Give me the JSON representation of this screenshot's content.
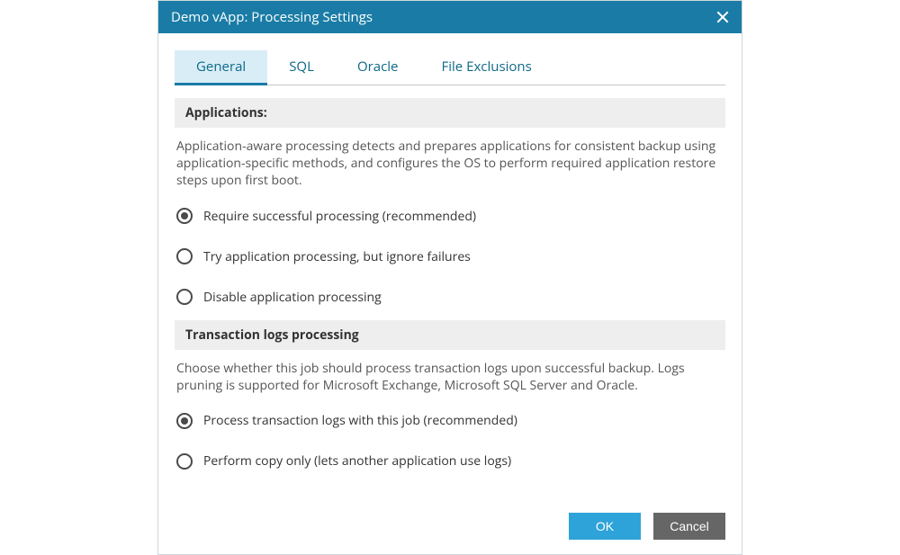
{
  "dialog": {
    "title": "Demo vApp: Processing Settings"
  },
  "tabs": {
    "items": [
      {
        "label": "General",
        "active": true
      },
      {
        "label": "SQL",
        "active": false
      },
      {
        "label": "Oracle",
        "active": false
      },
      {
        "label": "File Exclusions",
        "active": false
      }
    ]
  },
  "sections": {
    "applications": {
      "header": "Applications:",
      "description": "Application-aware processing detects and prepares applications for consistent backup using application-specific methods, and configures the OS to perform required application restore steps upon first boot.",
      "options": [
        {
          "label": "Require successful processing (recommended)",
          "checked": true
        },
        {
          "label": "Try application processing, but ignore failures",
          "checked": false
        },
        {
          "label": "Disable application processing",
          "checked": false
        }
      ]
    },
    "txlogs": {
      "header": "Transaction logs processing",
      "description": "Choose whether this job should process transaction logs upon successful backup. Logs pruning is supported for Microsoft Exchange, Microsoft SQL Server and Oracle.",
      "options": [
        {
          "label": "Process transaction logs with this job (recommended)",
          "checked": true
        },
        {
          "label": "Perform copy only (lets another application use logs)",
          "checked": false
        }
      ]
    }
  },
  "footer": {
    "ok_label": "OK",
    "cancel_label": "Cancel"
  }
}
